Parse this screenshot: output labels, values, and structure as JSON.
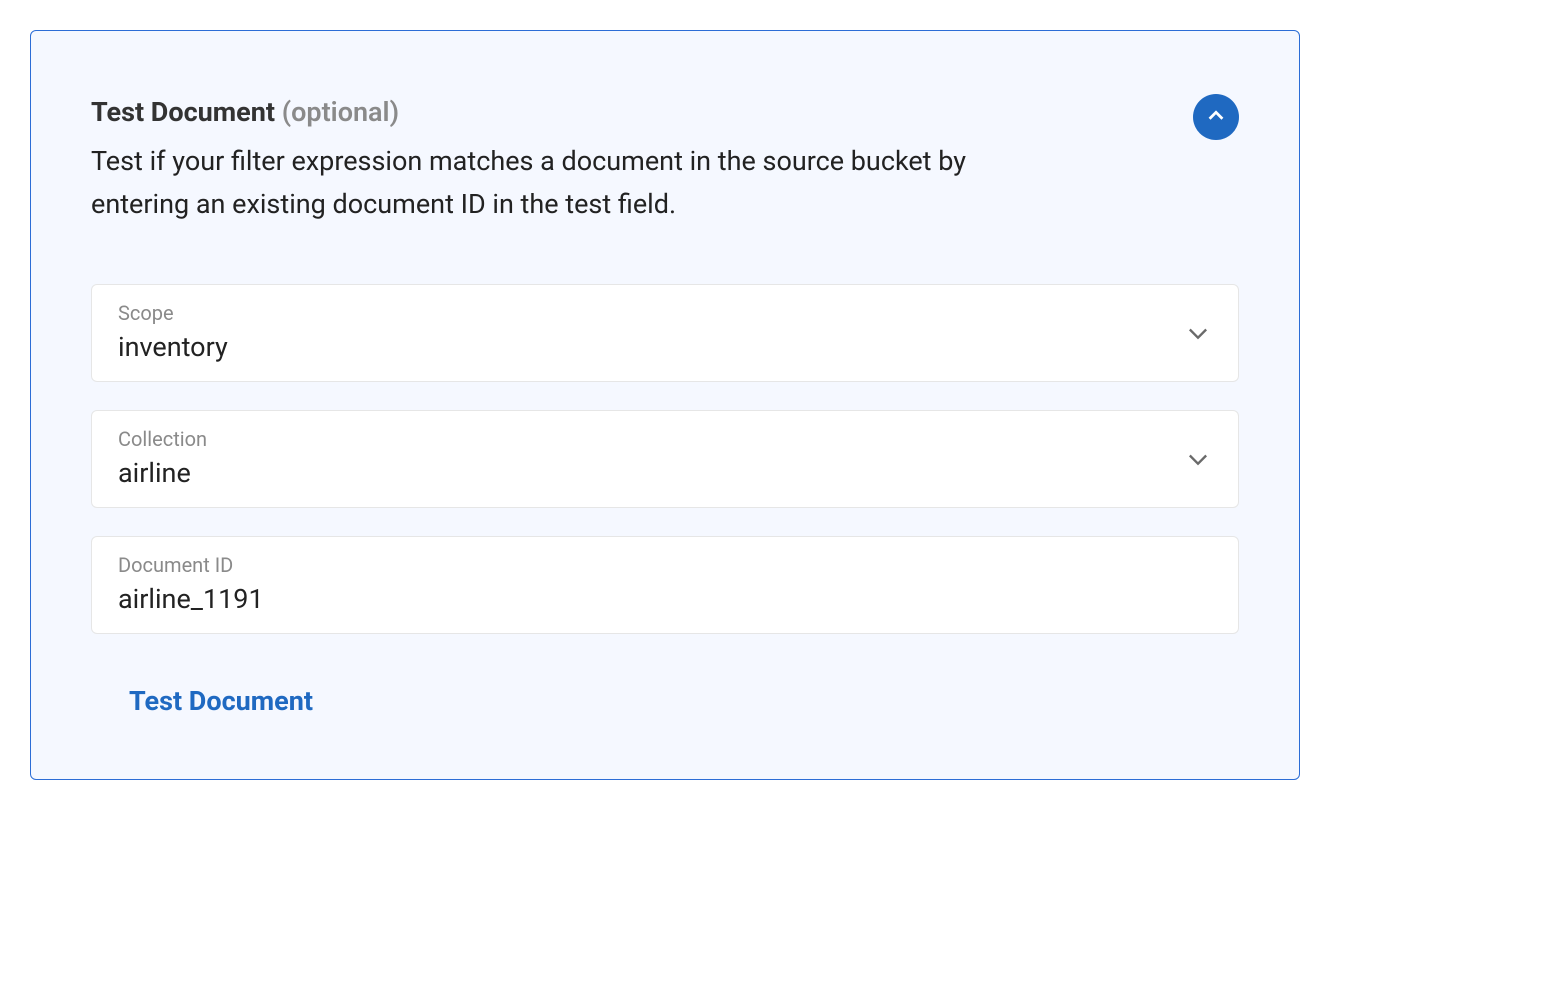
{
  "panel": {
    "title": "Test Document",
    "optional_label": "(optional)",
    "description": "Test if your filter expression matches a document in the source bucket by entering an existing document ID in the test field."
  },
  "fields": {
    "scope": {
      "label": "Scope",
      "value": "inventory"
    },
    "collection": {
      "label": "Collection",
      "value": "airline"
    },
    "document_id": {
      "label": "Document ID",
      "value": "airline_1191"
    }
  },
  "actions": {
    "test_button": "Test Document"
  }
}
